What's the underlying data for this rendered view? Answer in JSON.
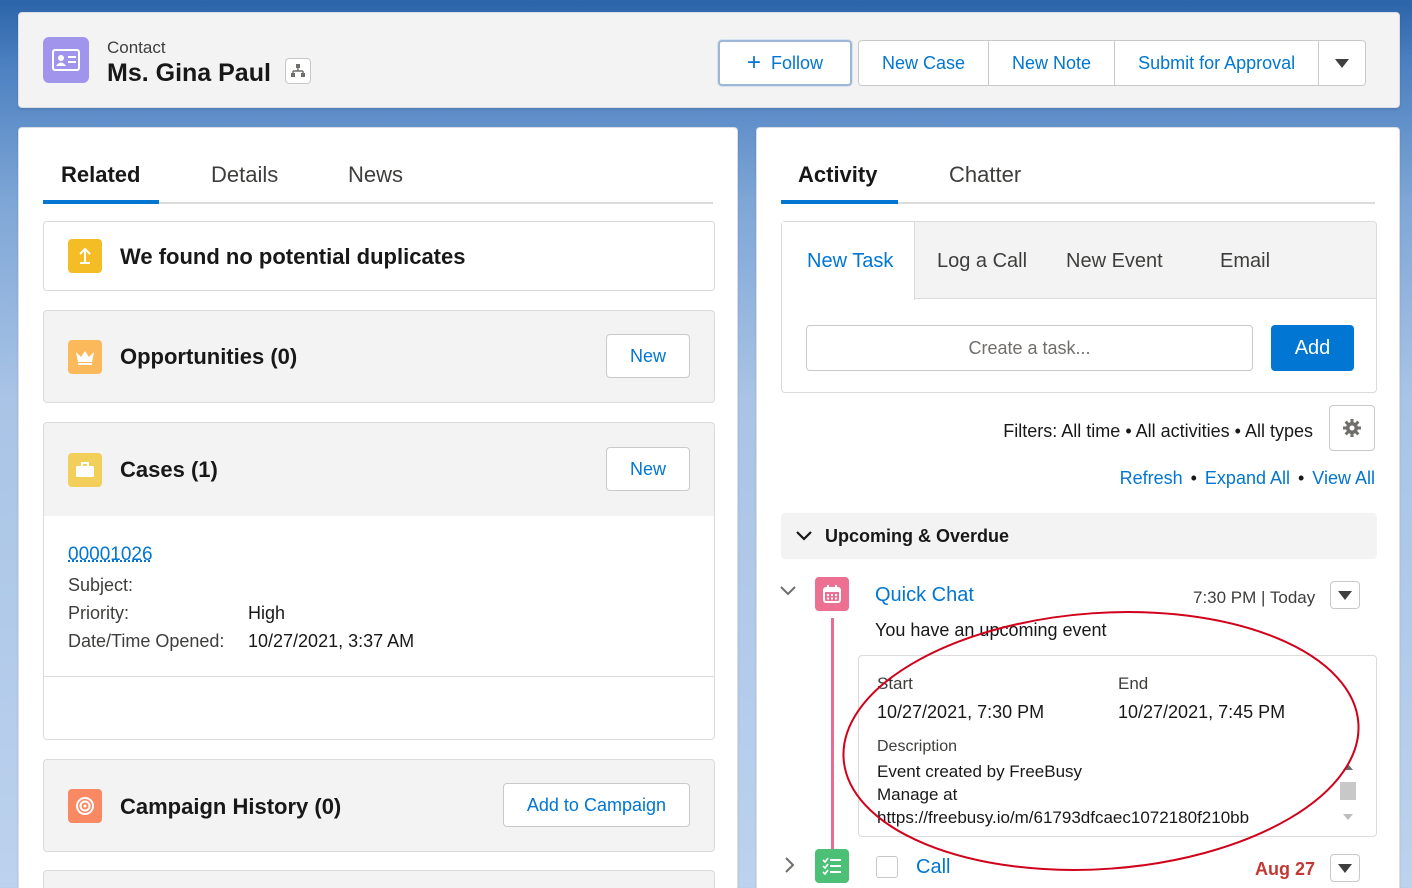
{
  "header": {
    "object_label": "Contact",
    "record_name": "Ms. Gina Paul",
    "follow_label": "Follow",
    "actions": [
      "New Case",
      "New Note",
      "Submit for Approval"
    ]
  },
  "left_tabs": [
    "Related",
    "Details",
    "News"
  ],
  "duplicates": {
    "title": "We found no potential duplicates"
  },
  "opportunities": {
    "title": "Opportunities (0)",
    "button": "New"
  },
  "cases": {
    "title": "Cases (1)",
    "button": "New",
    "record": {
      "number": "00001026",
      "subject_label": "Subject:",
      "priority_label": "Priority:",
      "priority_value": "High",
      "opened_label": "Date/Time Opened:",
      "opened_value": "10/27/2021, 3:37 AM"
    }
  },
  "campaign": {
    "title": "Campaign History (0)",
    "button": "Add to Campaign"
  },
  "right_tabs": [
    "Activity",
    "Chatter"
  ],
  "composer": {
    "tabs": [
      "New Task",
      "Log a Call",
      "New Event",
      "Email"
    ],
    "placeholder": "Create a task...",
    "add_label": "Add"
  },
  "filters_text": "Filters: All time • All activities • All types",
  "links": [
    "Refresh",
    "Expand All",
    "View All"
  ],
  "section_title": "Upcoming & Overdue",
  "event": {
    "title": "Quick Chat",
    "time": "7:30 PM | Today",
    "subtitle": "You have an upcoming event",
    "start_label": "Start",
    "start_value": "10/27/2021, 7:30 PM",
    "end_label": "End",
    "end_value": "10/27/2021, 7:45 PM",
    "description_label": "Description",
    "description_lines": [
      "Event created by FreeBusy",
      "Manage at",
      "https://freebusy.io/m/61793dfcaec1072180f210bb"
    ]
  },
  "call": {
    "title": "Call",
    "date": "Aug 27"
  },
  "colors": {
    "brand": "#0176d3",
    "contact_icon": "#a094ed",
    "annotation": "#d0021b",
    "overdue": "#c23934"
  }
}
